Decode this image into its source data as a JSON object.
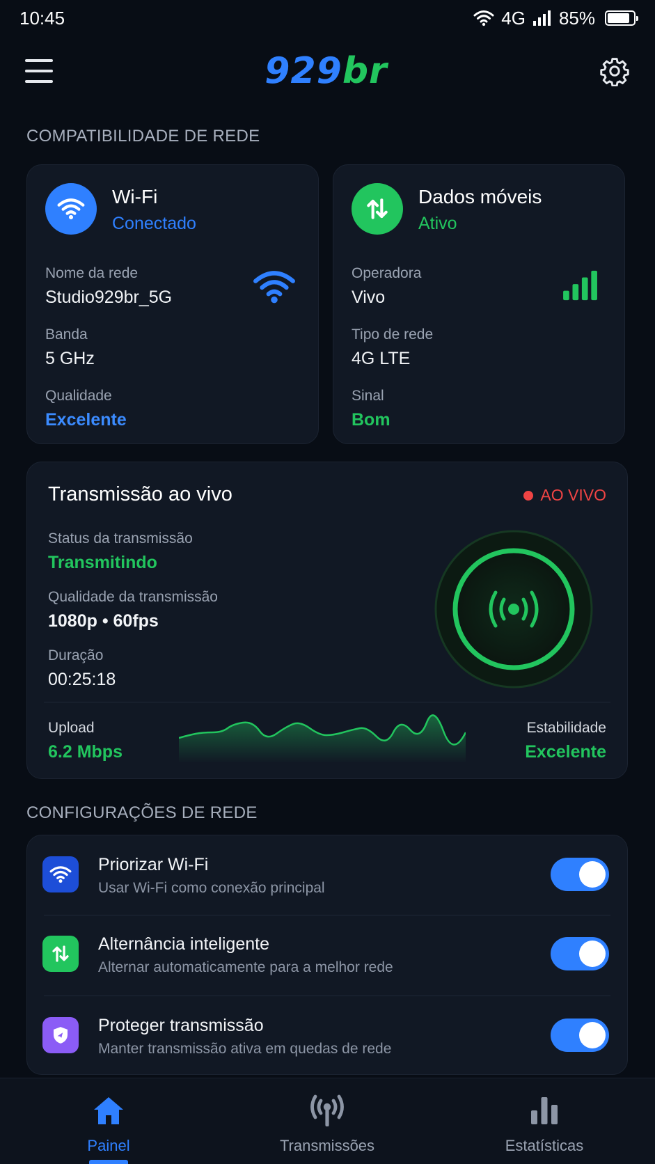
{
  "status_bar": {
    "time": "10:45",
    "network": "4G",
    "battery": "85%",
    "battery_level": 0.85
  },
  "header": {
    "logo_part1": "929",
    "logo_part2": "br"
  },
  "colors": {
    "accent_blue": "#2f80ff",
    "accent_green": "#22c55e",
    "live_red": "#ef4444",
    "background": "#080d15",
    "card": "#111824"
  },
  "compat": {
    "section_title": "COMPATIBILIDADE DE REDE",
    "wifi": {
      "title": "Wi-Fi",
      "state": "Conectado",
      "network_label": "Nome da rede",
      "network_value": "Studio929br_5G",
      "band_label": "Banda",
      "band_value": "5 GHz",
      "quality_label": "Qualidade",
      "quality_value": "Excelente"
    },
    "mobile": {
      "title": "Dados móveis",
      "state": "Ativo",
      "operator_label": "Operadora",
      "operator_value": "Vivo",
      "type_label": "Tipo de rede",
      "type_value": "4G LTE",
      "signal_label": "Sinal",
      "signal_value": "Bom"
    }
  },
  "live": {
    "title": "Transmissão ao vivo",
    "badge": "AO VIVO",
    "status_label": "Status da transmissão",
    "status_value": "Transmitindo",
    "quality_label": "Qualidade da transmissão",
    "quality_value": "1080p • 60fps",
    "duration_label": "Duração",
    "duration_value": "00:25:18",
    "upload_label": "Upload",
    "upload_value": "6.2 Mbps",
    "stability_label": "Estabilidade",
    "stability_value": "Excelente"
  },
  "settings": {
    "section_title": "CONFIGURAÇÕES DE REDE",
    "items": [
      {
        "title": "Priorizar Wi-Fi",
        "desc": "Usar Wi-Fi como conexão principal",
        "icon": "wifi-icon",
        "enabled": true
      },
      {
        "title": "Alternância inteligente",
        "desc": "Alternar automaticamente para a melhor rede",
        "icon": "swap-arrows-icon",
        "enabled": true
      },
      {
        "title": "Proteger transmissão",
        "desc": "Manter transmissão ativa em quedas de rede",
        "icon": "shield-icon",
        "enabled": true
      }
    ]
  },
  "nav": {
    "items": [
      {
        "label": "Painel",
        "icon": "home-icon",
        "active": true
      },
      {
        "label": "Transmissões",
        "icon": "broadcast-icon",
        "active": false
      },
      {
        "label": "Estatísticas",
        "icon": "bar-chart-icon",
        "active": false
      }
    ]
  }
}
